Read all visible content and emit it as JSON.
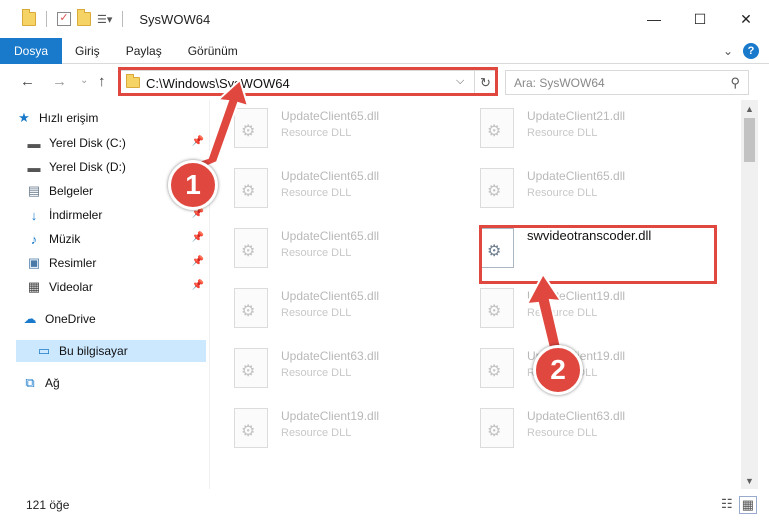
{
  "window": {
    "title": "SysWOW64",
    "minimize": "—",
    "maximize": "☐",
    "close": "✕"
  },
  "ribbon": {
    "tabs": [
      "Dosya",
      "Giriş",
      "Paylaş",
      "Görünüm"
    ],
    "expand": "⌄",
    "help": "?"
  },
  "nav": {
    "back": "←",
    "forward": "→",
    "recent": "⌄",
    "up": "↑",
    "address": "C:\\Windows\\SysWOW64",
    "address_dropdown": "⌵",
    "refresh": "↻",
    "search_placeholder": "Ara: SysWOW64",
    "search_icon": "⚲"
  },
  "sidebar": {
    "items": [
      {
        "label": "Hızlı erişim",
        "icon": "star-icon",
        "pinned": false
      },
      {
        "label": "Yerel Disk (C:)",
        "icon": "drive-icon",
        "pinned": true
      },
      {
        "label": "Yerel Disk (D:)",
        "icon": "drive-icon",
        "pinned": false
      },
      {
        "label": "Belgeler",
        "icon": "documents-icon",
        "pinned": true
      },
      {
        "label": "İndirmeler",
        "icon": "download-icon",
        "pinned": true
      },
      {
        "label": "Müzik",
        "icon": "music-icon",
        "pinned": true
      },
      {
        "label": "Resimler",
        "icon": "pictures-icon",
        "pinned": true
      },
      {
        "label": "Videolar",
        "icon": "video-icon",
        "pinned": true
      },
      {
        "label": "OneDrive",
        "icon": "cloud-icon",
        "pinned": false
      },
      {
        "label": "Bu bilgisayar",
        "icon": "computer-icon",
        "pinned": false,
        "selected": true
      },
      {
        "label": "Ağ",
        "icon": "network-icon",
        "pinned": false
      }
    ]
  },
  "files": {
    "left": [
      {
        "name": "UpdateClient65.dll",
        "type": "Resource DLL"
      },
      {
        "name": "UpdateClient65.dll",
        "type": "Resource DLL"
      },
      {
        "name": "UpdateClient65.dll",
        "type": "Resource DLL"
      },
      {
        "name": "UpdateClient65.dll",
        "type": "Resource DLL"
      },
      {
        "name": "UpdateClient63.dll",
        "type": "Resource DLL"
      },
      {
        "name": "UpdateClient19.dll",
        "type": "Resource DLL"
      }
    ],
    "right": [
      {
        "name": "UpdateClient21.dll",
        "type": "Resource DLL"
      },
      {
        "name": "UpdateClient65.dll",
        "type": "Resource DLL"
      },
      {
        "name": "swvideotranscoder.dll",
        "type": "",
        "highlighted": true
      },
      {
        "name": "UpdateClient19.dll",
        "type": "Resource DLL"
      },
      {
        "name": "UpdateClient19.dll",
        "type": "Resource DLL"
      },
      {
        "name": "UpdateClient63.dll",
        "type": "Resource DLL"
      }
    ]
  },
  "status": {
    "count": "121 öğe"
  },
  "annotations": {
    "marker_1": "1",
    "marker_2": "2",
    "color": "#e0473f"
  },
  "colors": {
    "accent": "#1979ca",
    "selection": "#cce8ff"
  }
}
